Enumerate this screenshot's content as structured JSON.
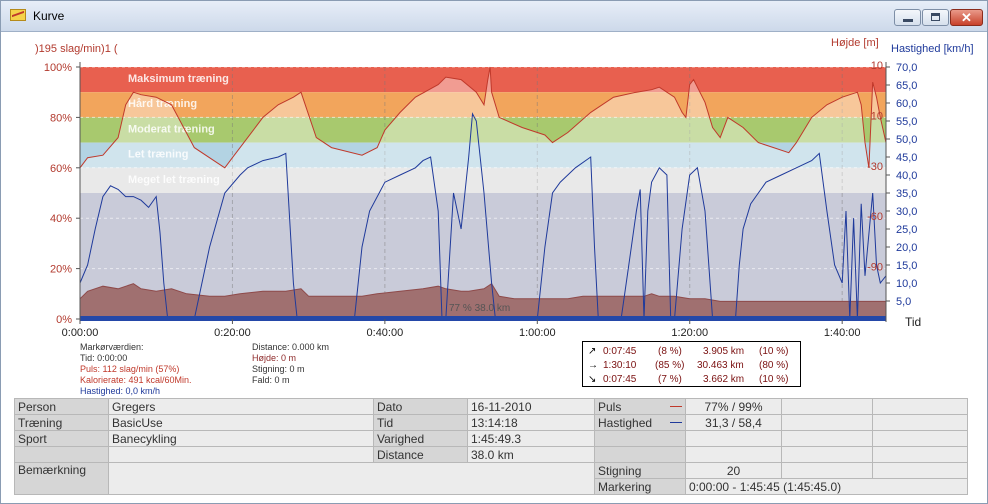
{
  "window": {
    "title": "Kurve"
  },
  "chart": {
    "left_label": ")195 slag/min)1 (",
    "right_label_height": "Højde [m]",
    "right_label_speed": "Hastighed [km/h]",
    "time_label": "Tid",
    "pct_ticks": [
      "100%",
      "80%",
      "60%",
      "40%",
      "20%",
      "0%"
    ],
    "height_ticks": [
      "10",
      "10",
      "-30",
      "-60",
      "-90"
    ],
    "speed_ticks": [
      "70,0",
      "65,0",
      "60,0",
      "55,0",
      "50,0",
      "45,0",
      "40,0",
      "35,0",
      "30,0",
      "25,0",
      "20,0",
      "15,0",
      "10,0",
      "5,0"
    ],
    "time_ticks": [
      "0:00:00",
      "0:20:00",
      "0:40:00",
      "1:00:00",
      "1:20:00",
      "1:40:00"
    ],
    "zones": [
      "Maksimum træning",
      "Hård træning",
      "Moderat træning",
      "Let træning",
      "Meget let træning"
    ],
    "marker_label": "77 % 38.0 km",
    "colors": {
      "max": "#e8604f",
      "hard": "#f2a55c",
      "moderate": "#a8c96e",
      "light": "#b3d3e3",
      "verylight": "#dcdcdc",
      "base": "#c9cbd9",
      "pulse": "#c0392b",
      "speed": "#1f3a9b",
      "height": "#8e4a4a"
    }
  },
  "chart_data": {
    "type": "line",
    "x_unit": "minutes",
    "xlim": [
      0,
      105.75
    ],
    "series": [
      {
        "name": "Puls",
        "axis": "percent",
        "points": [
          [
            0,
            60
          ],
          [
            1,
            64
          ],
          [
            3,
            65
          ],
          [
            5,
            72
          ],
          [
            6,
            85
          ],
          [
            7,
            90
          ],
          [
            8,
            89
          ],
          [
            10,
            88
          ],
          [
            12,
            85
          ],
          [
            15,
            68
          ],
          [
            18,
            62
          ],
          [
            19,
            60
          ],
          [
            20,
            64
          ],
          [
            22,
            72
          ],
          [
            24,
            80
          ],
          [
            26,
            85
          ],
          [
            28,
            88
          ],
          [
            29,
            90
          ],
          [
            31,
            72
          ],
          [
            33,
            68
          ],
          [
            37,
            65
          ],
          [
            39,
            68
          ],
          [
            40,
            75
          ],
          [
            42,
            82
          ],
          [
            44,
            88
          ],
          [
            47,
            93
          ],
          [
            48,
            96
          ],
          [
            50,
            95
          ],
          [
            52,
            90
          ],
          [
            53,
            85
          ],
          [
            53.5,
            95
          ],
          [
            53.8,
            100
          ],
          [
            54,
            90
          ],
          [
            55,
            80
          ],
          [
            58,
            76
          ],
          [
            61,
            73
          ],
          [
            62,
            70
          ],
          [
            64,
            74
          ],
          [
            67,
            82
          ],
          [
            70,
            88
          ],
          [
            73,
            90
          ],
          [
            75,
            91
          ],
          [
            76,
            92
          ],
          [
            78,
            88
          ],
          [
            79,
            82
          ],
          [
            79.5,
            80
          ],
          [
            80,
            93
          ],
          [
            80.5,
            95
          ],
          [
            81,
            92
          ],
          [
            82,
            86
          ],
          [
            83,
            76
          ],
          [
            84,
            72
          ],
          [
            85,
            80
          ],
          [
            87,
            76
          ],
          [
            89,
            70
          ],
          [
            91,
            68
          ],
          [
            93,
            66
          ],
          [
            94,
            70
          ],
          [
            96,
            80
          ],
          [
            98,
            85
          ],
          [
            100,
            88
          ],
          [
            102,
            90
          ],
          [
            102.5,
            85
          ],
          [
            103,
            70
          ],
          [
            103.5,
            60
          ],
          [
            104,
            94
          ],
          [
            104.5,
            88
          ],
          [
            105,
            80
          ],
          [
            105.75,
            70
          ]
        ]
      },
      {
        "name": "Hastighed",
        "axis": "km/h",
        "points": [
          [
            0,
            10
          ],
          [
            1,
            15
          ],
          [
            2,
            25
          ],
          [
            3,
            34
          ],
          [
            4,
            37
          ],
          [
            5,
            36
          ],
          [
            6,
            34
          ],
          [
            7,
            34
          ],
          [
            8,
            33
          ],
          [
            9,
            31
          ],
          [
            10,
            34
          ],
          [
            10.5,
            24
          ],
          [
            11,
            10
          ],
          [
            11.5,
            0
          ],
          [
            15,
            0
          ],
          [
            17,
            20
          ],
          [
            19,
            35
          ],
          [
            21,
            40
          ],
          [
            22,
            42
          ],
          [
            24,
            44
          ],
          [
            26,
            45
          ],
          [
            27,
            46
          ],
          [
            28,
            10
          ],
          [
            28.5,
            0
          ],
          [
            36,
            0
          ],
          [
            37,
            20
          ],
          [
            38,
            30
          ],
          [
            40,
            38
          ],
          [
            42,
            40
          ],
          [
            44,
            42
          ],
          [
            45,
            44
          ],
          [
            46,
            45
          ],
          [
            47,
            30
          ],
          [
            47.5,
            0
          ],
          [
            48,
            0
          ],
          [
            49,
            35
          ],
          [
            50,
            25
          ],
          [
            51,
            45
          ],
          [
            51.5,
            57
          ],
          [
            52,
            55
          ],
          [
            53,
            35
          ],
          [
            54,
            10
          ],
          [
            54.5,
            0
          ],
          [
            60,
            0
          ],
          [
            61,
            20
          ],
          [
            62,
            35
          ],
          [
            63,
            38
          ],
          [
            65,
            42
          ],
          [
            67,
            45
          ],
          [
            67.5,
            20
          ],
          [
            68,
            0
          ],
          [
            71,
            0
          ],
          [
            72,
            15
          ],
          [
            73,
            30
          ],
          [
            73.5,
            36
          ],
          [
            74,
            0
          ],
          [
            74.5,
            30
          ],
          [
            75,
            38
          ],
          [
            76,
            42
          ],
          [
            77,
            40
          ],
          [
            77.5,
            0
          ],
          [
            78,
            0
          ],
          [
            79,
            25
          ],
          [
            80,
            40
          ],
          [
            81,
            42
          ],
          [
            82,
            30
          ],
          [
            83,
            0
          ],
          [
            86,
            0
          ],
          [
            86.5,
            15
          ],
          [
            87,
            25
          ],
          [
            88,
            32
          ],
          [
            90,
            38
          ],
          [
            92,
            40
          ],
          [
            94,
            42
          ],
          [
            96,
            44
          ],
          [
            97,
            46
          ],
          [
            98,
            30
          ],
          [
            99,
            15
          ],
          [
            100,
            10
          ],
          [
            100.5,
            30
          ],
          [
            101,
            0
          ],
          [
            101.5,
            28
          ],
          [
            102,
            0
          ],
          [
            102.5,
            32
          ],
          [
            103,
            12
          ],
          [
            104,
            35
          ],
          [
            104.5,
            15
          ],
          [
            105,
            10
          ],
          [
            105.75,
            12
          ]
        ]
      },
      {
        "name": "Højde",
        "axis": "percent",
        "points": [
          [
            0,
            8
          ],
          [
            1,
            11
          ],
          [
            3,
            13
          ],
          [
            5,
            12
          ],
          [
            7,
            14
          ],
          [
            8,
            12
          ],
          [
            10,
            11
          ],
          [
            12,
            12
          ],
          [
            14,
            10
          ],
          [
            17,
            9
          ],
          [
            19,
            9
          ],
          [
            21,
            10
          ],
          [
            24,
            11
          ],
          [
            27,
            11
          ],
          [
            29,
            12
          ],
          [
            30,
            9
          ],
          [
            33,
            9
          ],
          [
            37,
            9
          ],
          [
            39,
            10
          ],
          [
            42,
            11
          ],
          [
            45,
            12
          ],
          [
            47,
            13
          ],
          [
            48,
            12
          ],
          [
            50,
            11
          ],
          [
            51,
            11
          ],
          [
            53,
            12
          ],
          [
            54,
            14
          ],
          [
            55,
            9
          ],
          [
            57,
            8
          ],
          [
            60,
            8
          ],
          [
            62,
            8
          ],
          [
            64,
            8
          ],
          [
            66,
            9
          ],
          [
            68,
            9
          ],
          [
            70,
            9
          ],
          [
            72,
            9
          ],
          [
            74,
            9
          ],
          [
            75,
            10
          ],
          [
            76,
            9
          ],
          [
            78,
            9
          ],
          [
            80,
            8
          ],
          [
            82,
            8
          ],
          [
            84,
            7
          ],
          [
            86,
            7
          ],
          [
            88,
            7
          ],
          [
            90,
            7
          ],
          [
            92,
            7
          ],
          [
            94,
            7
          ],
          [
            96,
            7
          ],
          [
            98,
            7
          ],
          [
            100,
            7
          ],
          [
            102,
            7
          ],
          [
            104,
            7
          ],
          [
            105.75,
            7
          ]
        ]
      }
    ],
    "zone_bounds_percent": [
      [
        90,
        100
      ],
      [
        80,
        90
      ],
      [
        70,
        80
      ],
      [
        60,
        70
      ],
      [
        50,
        60
      ]
    ],
    "ylim_percent": [
      0,
      100
    ],
    "ylim_speed": [
      0,
      70
    ],
    "grid": true
  },
  "info_left": {
    "title": "Markørværdien:",
    "time": "Tid: 0:00:00",
    "pulse": "Puls: 112 slag/min (57%)",
    "calories": "Kalorierate: 491 kcal/60Min.",
    "speed": "Hastighed: 0,0 km/h"
  },
  "info_mid": {
    "distance": "Distance: 0.000 km",
    "height": "Højde: 0 m",
    "climb": "Stigning: 0 m",
    "fall": "Fald: 0 m"
  },
  "laps": [
    {
      "arrow": "↗",
      "time": "0:07:45",
      "pct": "(8 %)",
      "dist": "3.905 km",
      "dpct": "(10 %)"
    },
    {
      "arrow": "→",
      "time": "1:30:10",
      "pct": "(85 %)",
      "dist": "30.463 km",
      "dpct": "(80 %)"
    },
    {
      "arrow": "↘",
      "time": "0:07:45",
      "pct": "(7 %)",
      "dist": "3.662 km",
      "dpct": "(10 %)"
    }
  ],
  "summary": {
    "person_label": "Person",
    "person": "Gregers",
    "training_label": "Træning",
    "training": "BasicUse",
    "sport_label": "Sport",
    "sport": "Banecykling",
    "remark_label": "Bemærkning",
    "date_label": "Dato",
    "date": "16-11-2010",
    "time_label": "Tid",
    "time": "13:14:18",
    "duration_label": "Varighed",
    "duration": "1:45:49.3",
    "distance_label": "Distance",
    "distance": "38.0 km",
    "pulse_label": "Puls",
    "pulse": "77% / 99%",
    "speed_label": "Hastighed",
    "speed": "31,3 / 58,4",
    "climb_label": "Stigning",
    "climb": "20",
    "marking_label": "Markering",
    "marking": "0:00:00 - 1:45:45 (1:45:45.0)"
  }
}
